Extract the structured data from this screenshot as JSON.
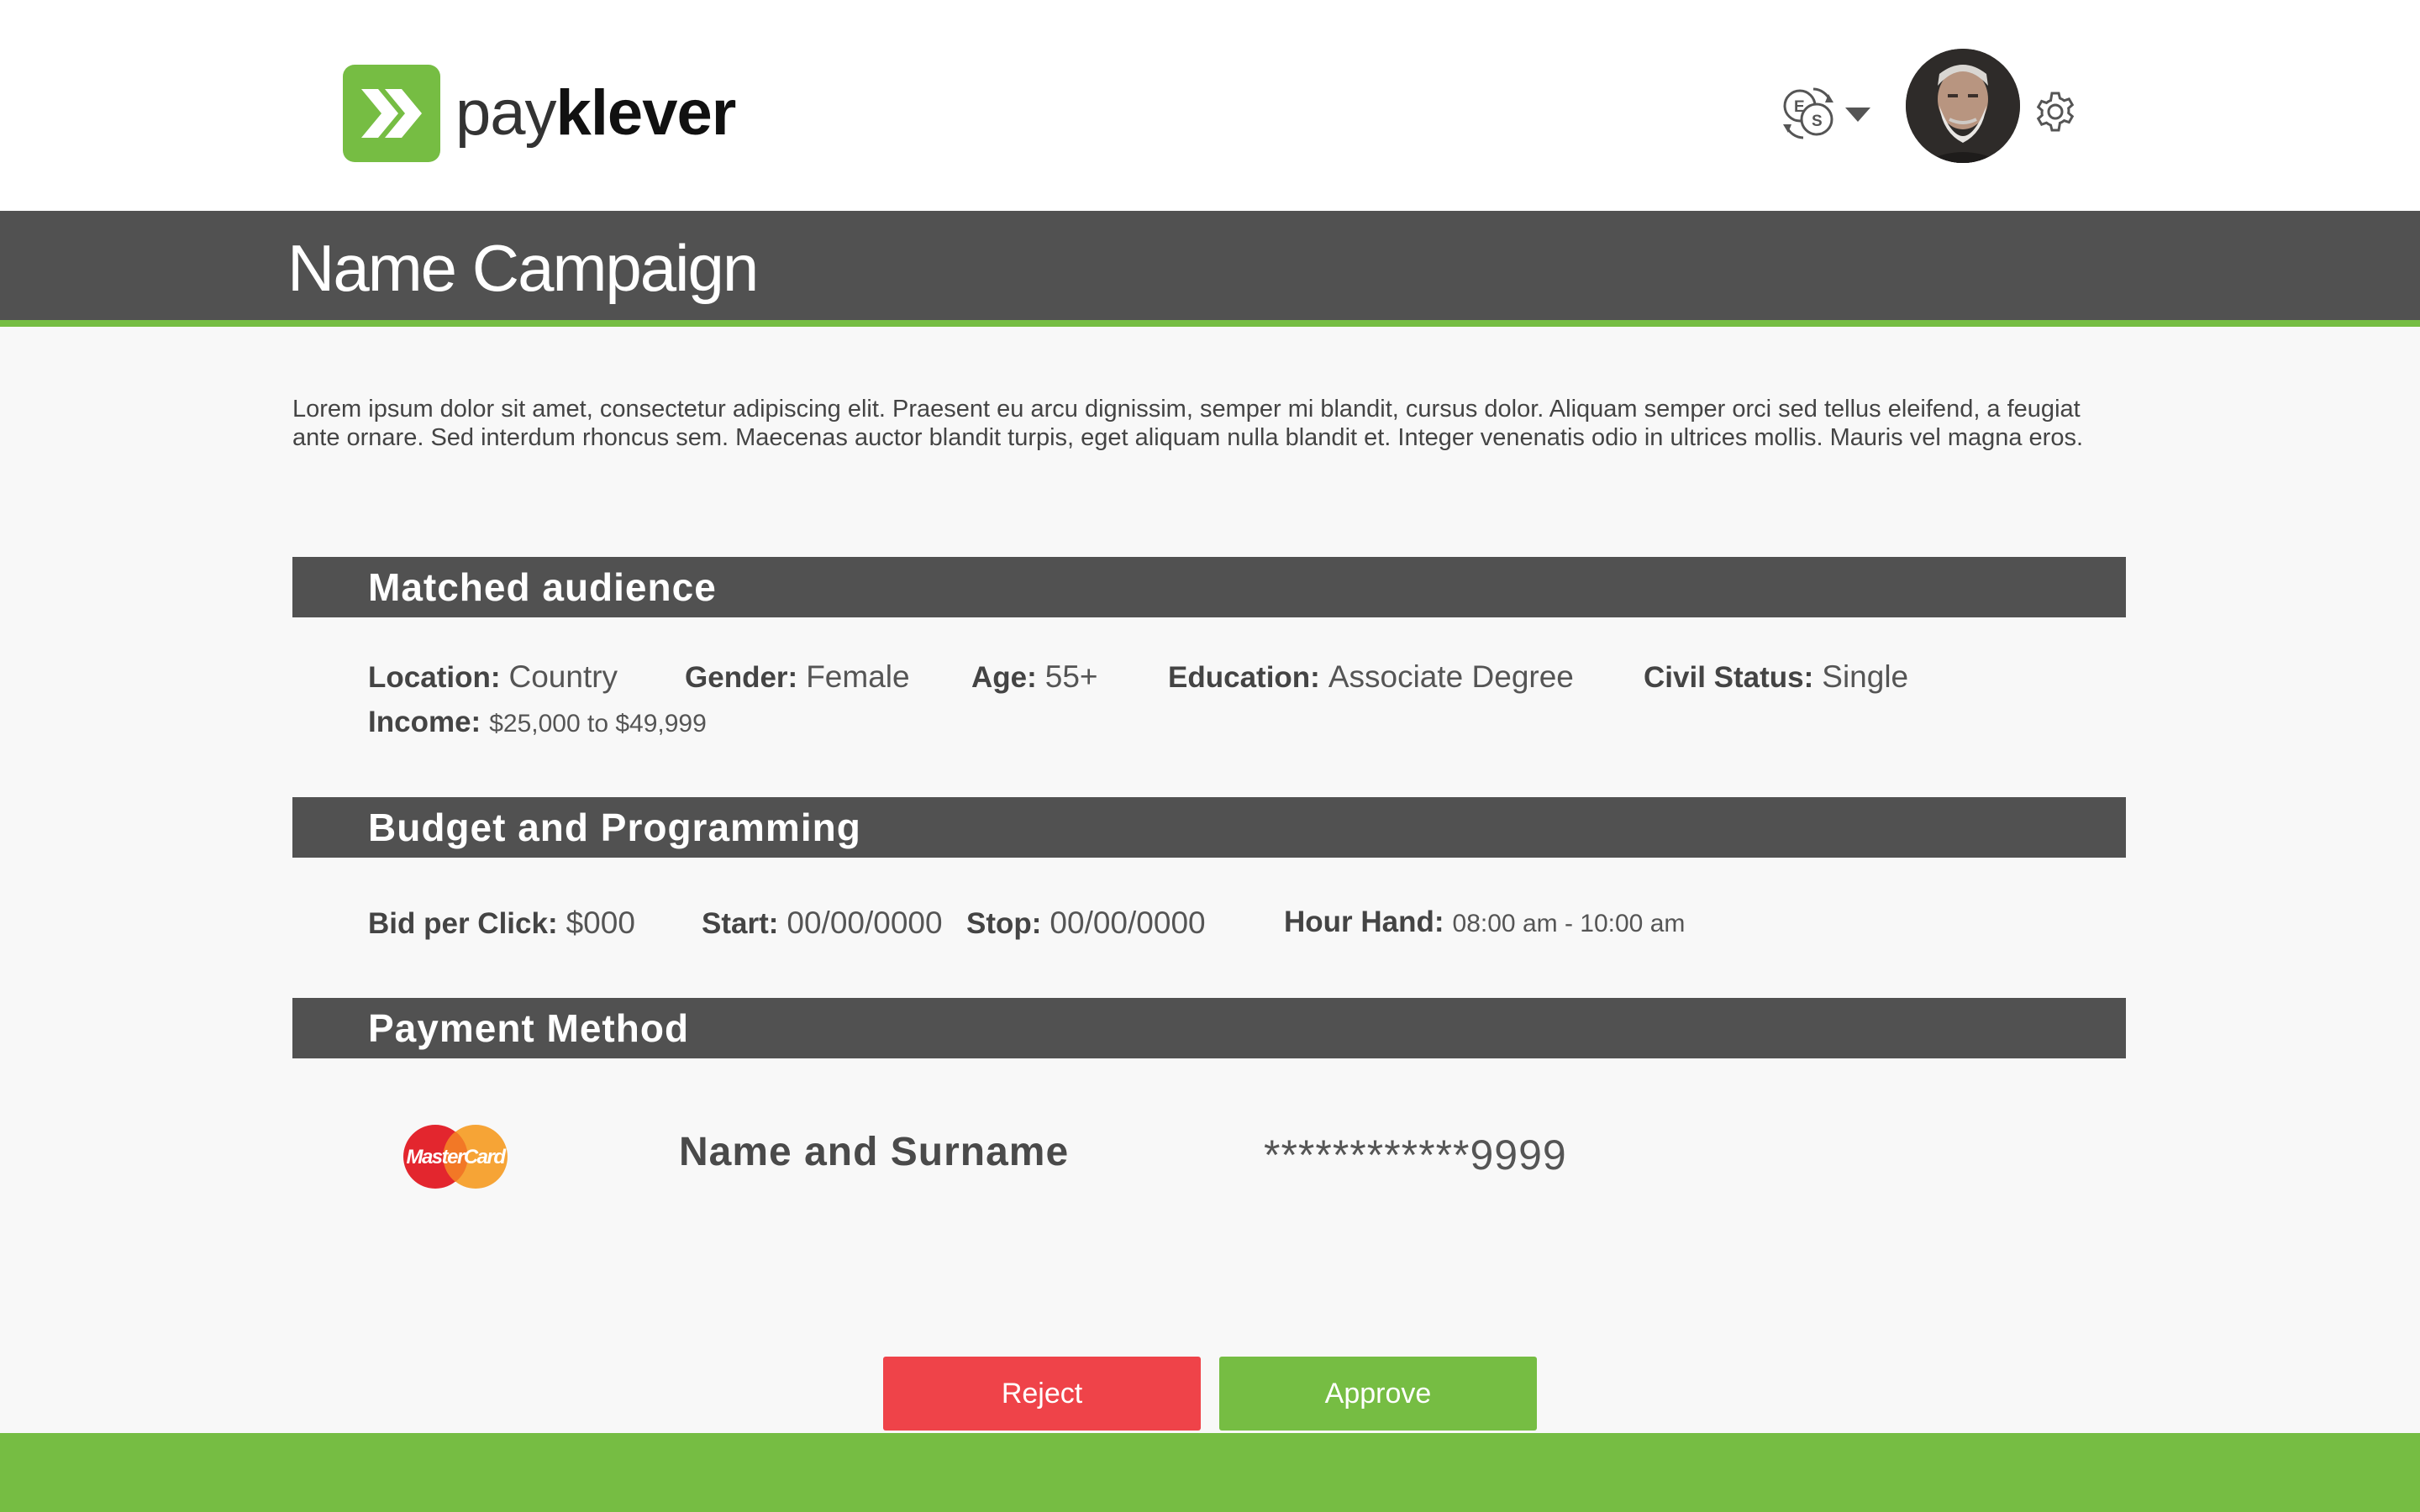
{
  "brand": {
    "name_light": "pay",
    "name_bold": "klever",
    "accent_color": "#76bd43",
    "logo_icon": "double-chevron-right-icon"
  },
  "header": {
    "currency_icon": "currency-exchange-icon",
    "currency_glyph_top": "E",
    "currency_glyph_bottom": "S",
    "avatar": "user-avatar",
    "settings_icon": "gear-icon"
  },
  "page": {
    "title": "Name Campaign",
    "intro": "Lorem ipsum dolor sit amet, consectetur adipiscing elit. Praesent eu arcu dignissim, semper mi blandit, cursus dolor. Aliquam semper orci sed tellus eleifend, a feugiat ante ornare. Sed interdum rhoncus sem. Maecenas auctor blandit turpis, eget aliquam nulla blandit et. Integer venenatis odio in ultrices mollis. Mauris vel magna eros."
  },
  "audience": {
    "heading": "Matched audience",
    "location_label": "Location:",
    "location_value": "Country",
    "gender_label": "Gender:",
    "gender_value": "Female",
    "age_label": "Age:",
    "age_value": "55+",
    "education_label": "Education:",
    "education_value": "Associate Degree",
    "civil_label": "Civil Status:",
    "civil_value": "Single",
    "income_label": "Income:",
    "income_value": "$25,000 to $49,999"
  },
  "budget": {
    "heading": "Budget and Programming",
    "bid_label": "Bid per Click:",
    "bid_value": "$000",
    "start_label": "Start:",
    "start_value": "00/00/0000",
    "stop_label": "Stop:",
    "stop_value": "00/00/0000",
    "hour_label": "Hour Hand:",
    "hour_value": "08:00 am - 10:00 am"
  },
  "payment": {
    "heading": "Payment Method",
    "card_brand": "MasterCard",
    "card_icon": "mastercard-icon",
    "holder": "Name and Surname",
    "number": "************9999"
  },
  "actions": {
    "reject_label": "Reject",
    "approve_label": "Approve",
    "reject_color": "#ef4349",
    "approve_color": "#76bd43"
  }
}
